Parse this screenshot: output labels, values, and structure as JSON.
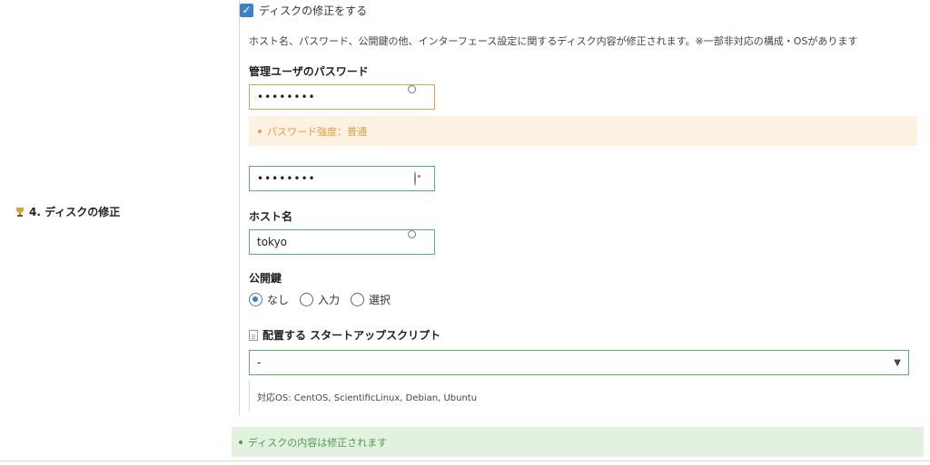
{
  "section": {
    "label": "4. ディスクの修正",
    "icon": "trophy-icon"
  },
  "disk_edit": {
    "checkbox_label": "ディスクの修正をする",
    "checked": true,
    "description": "ホスト名、パスワード、公開鍵の他、インターフェース設定に関するディスク内容が修正されます。※一部非対応の構成・OSがあります"
  },
  "password": {
    "label": "管理ユーザのパスワード",
    "value": "••••••••",
    "confirm_value": "••••••••",
    "strength_text": "パスワード強度：普通"
  },
  "hostname": {
    "label": "ホスト名",
    "value": "tokyo"
  },
  "public_key": {
    "label": "公開鍵",
    "options": [
      "なし",
      "入力",
      "選択"
    ],
    "selected": "なし"
  },
  "startup_script": {
    "label": "配置する スタートアップスクリプト",
    "selected_value": "-",
    "os_note": "対応OS: CentOS, ScientificLinux, Debian, Ubuntu"
  },
  "footer_info": "ディスクの内容は修正されます",
  "colors": {
    "accent_blue": "#3d82c5",
    "input_border_green": "#5fb06b",
    "warning_bg": "#fdf1e2",
    "warning_text": "#e0a040",
    "info_bg": "#e2f1e0",
    "info_text": "#4f9a4d"
  }
}
